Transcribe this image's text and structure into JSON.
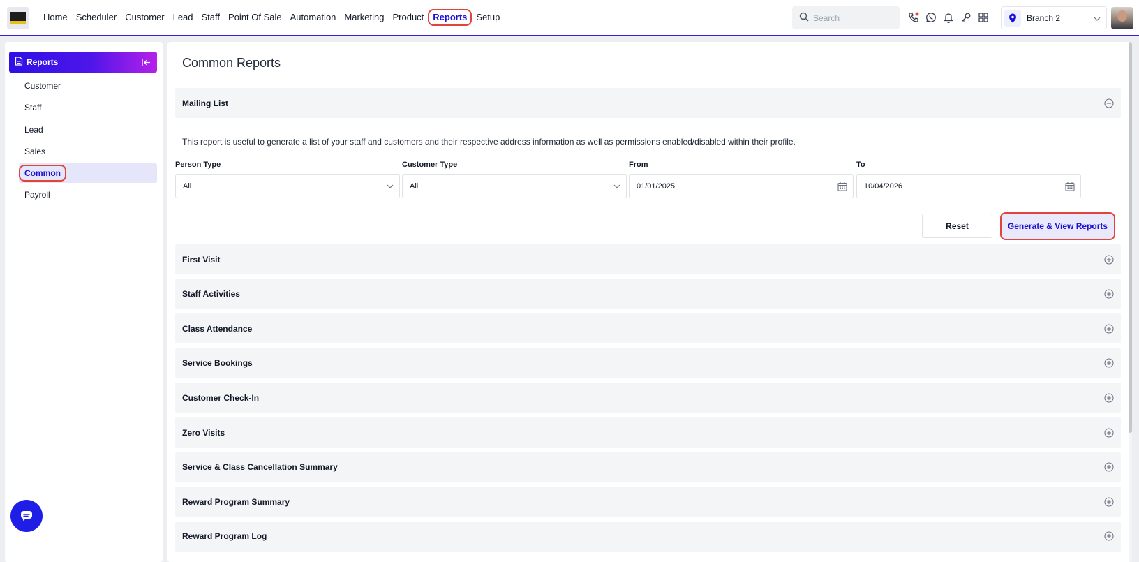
{
  "topbar": {
    "nav": [
      {
        "label": "Home",
        "name": "nav-home"
      },
      {
        "label": "Scheduler",
        "name": "nav-scheduler"
      },
      {
        "label": "Customer",
        "name": "nav-customer"
      },
      {
        "label": "Lead",
        "name": "nav-lead"
      },
      {
        "label": "Staff",
        "name": "nav-staff"
      },
      {
        "label": "Point Of Sale",
        "name": "nav-point-of-sale"
      },
      {
        "label": "Automation",
        "name": "nav-automation"
      },
      {
        "label": "Marketing",
        "name": "nav-marketing"
      },
      {
        "label": "Product",
        "name": "nav-product"
      },
      {
        "label": "Reports",
        "name": "nav-reports",
        "active": true
      },
      {
        "label": "Setup",
        "name": "nav-setup"
      }
    ],
    "search_placeholder": "Search",
    "branch": "Branch 2",
    "icons": [
      "phone-icon",
      "whatsapp-icon",
      "bell-icon",
      "key-icon",
      "apps-grid-icon"
    ]
  },
  "sidebar": {
    "title": "Reports",
    "items": [
      {
        "label": "Customer",
        "name": "sidebar-item-customer"
      },
      {
        "label": "Staff",
        "name": "sidebar-item-staff"
      },
      {
        "label": "Lead",
        "name": "sidebar-item-lead"
      },
      {
        "label": "Sales",
        "name": "sidebar-item-sales"
      },
      {
        "label": "Common",
        "name": "sidebar-item-common",
        "active": true
      },
      {
        "label": "Payroll",
        "name": "sidebar-item-payroll"
      }
    ]
  },
  "main": {
    "title": "Common Reports",
    "expanded": {
      "title": "Mailing List",
      "description": "This report is useful to generate a list of your staff and customers and their respective address information as well as permissions enabled/disabled within their profile.",
      "person_type_label": "Person Type",
      "person_type_value": "All",
      "customer_type_label": "Customer Type",
      "customer_type_value": "All",
      "from_label": "From",
      "from_value": "01/01/2025",
      "to_label": "To",
      "to_value": "10/04/2026",
      "reset_label": "Reset",
      "generate_label": "Generate & View Reports"
    },
    "collapsed": [
      "First Visit",
      "Staff Activities",
      "Class Attendance",
      "Service Bookings",
      "Customer Check-In",
      "Zero Visits",
      "Service & Class Cancellation Summary",
      "Reward Program Summary",
      "Reward Program Log"
    ]
  },
  "colors": {
    "accent": "#1d10d6",
    "highlight": "#e0443a",
    "header_gradient_start": "#2e10e6",
    "header_gradient_end": "#b620ea"
  }
}
